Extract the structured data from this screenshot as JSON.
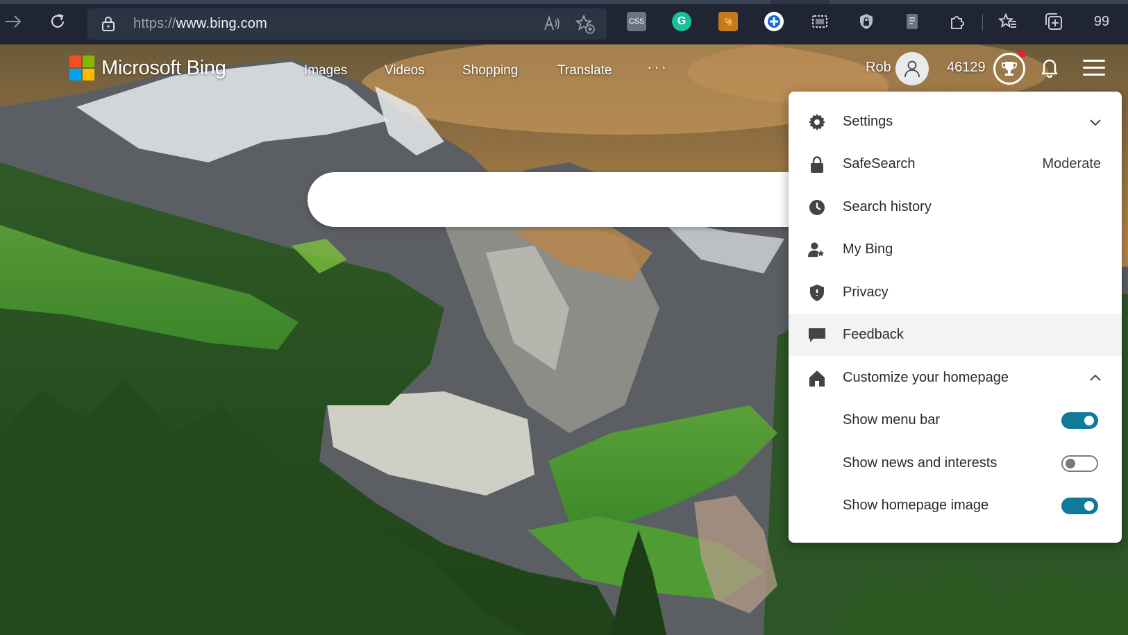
{
  "browser": {
    "address": {
      "protocol": "https://",
      "host": "www.bing.com"
    },
    "readaloud_icon": "A))",
    "extensions": [
      "css-viewer-icon",
      "grammarly-icon",
      "camel-icon",
      "plus-ext-icon",
      "screenshot-icon",
      "shield-ext-icon",
      "page-ext-icon"
    ],
    "right_label": "99"
  },
  "header": {
    "brand": "Microsoft Bing",
    "nav": [
      "Images",
      "Videos",
      "Shopping",
      "Translate"
    ],
    "more": "···",
    "user_name": "Rob",
    "points": "46129"
  },
  "search": {
    "placeholder": ""
  },
  "menu": {
    "items": [
      {
        "label": "Settings",
        "icon": "gear-icon"
      },
      {
        "label": "SafeSearch",
        "value": "Moderate",
        "icon": "lock-icon"
      },
      {
        "label": "Search history",
        "icon": "clock-icon"
      },
      {
        "label": "My Bing",
        "icon": "user-star-icon"
      },
      {
        "label": "Privacy",
        "icon": "shield-icon"
      },
      {
        "label": "Feedback",
        "icon": "chat-icon"
      },
      {
        "label": "Customize your homepage",
        "icon": "home-icon"
      }
    ],
    "toggles": [
      {
        "label": "Show menu bar",
        "on": true
      },
      {
        "label": "Show news and interests",
        "on": false
      },
      {
        "label": "Show homepage image",
        "on": true
      }
    ]
  },
  "colors": {
    "toggle_on": "#0f7a99",
    "logo": [
      "#f25022",
      "#7fba00",
      "#00a4ef",
      "#ffb900"
    ]
  }
}
